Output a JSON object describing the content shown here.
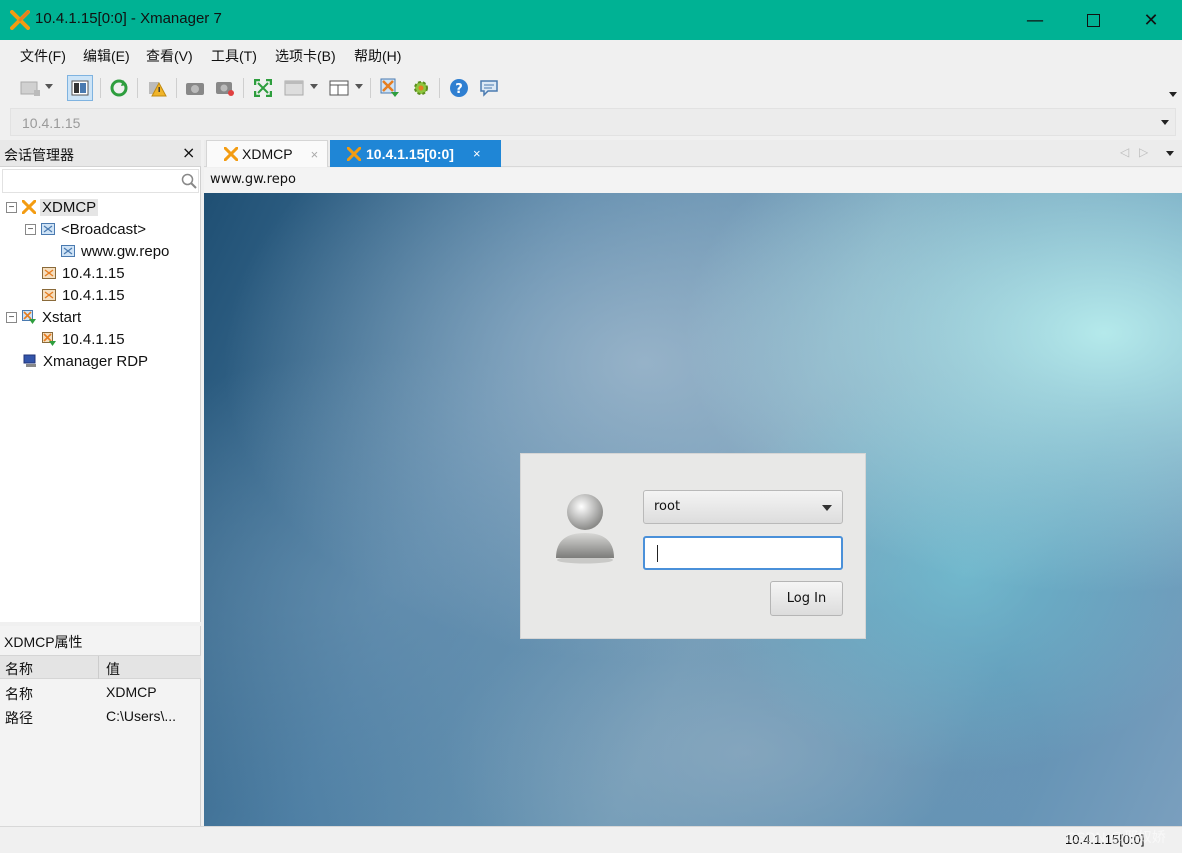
{
  "window": {
    "title": "10.4.1.15[0:0] - Xmanager 7"
  },
  "menu": {
    "items": [
      "文件(F)",
      "编辑(E)",
      "查看(V)",
      "工具(T)",
      "选项卡(B)",
      "帮助(H)"
    ]
  },
  "toolbar": {
    "icons": [
      "new-session-icon",
      "session-panel-icon",
      "refresh-icon",
      "warning-icon",
      "screenshot-icon",
      "record-icon",
      "fullscreen-icon",
      "window-icon",
      "layout-icon",
      "xstart-icon",
      "settings-icon",
      "help-icon",
      "chat-icon"
    ]
  },
  "address": {
    "value": "10.4.1.15"
  },
  "session_manager": {
    "title": "会话管理器",
    "tree": {
      "xdmcp": "XDMCP",
      "broadcast": "<Broadcast>",
      "broadcast_child": "www.gw.repo",
      "xdmcp_host1": "10.4.1.15",
      "xdmcp_host2": "10.4.1.15",
      "xstart": "Xstart",
      "xstart_host": "10.4.1.15",
      "rdp": "Xmanager RDP"
    }
  },
  "properties": {
    "title": "XDMCP属性",
    "col_name": "名称",
    "col_value": "值",
    "rows": [
      {
        "name": "名称",
        "value": "XDMCP"
      },
      {
        "name": "路径",
        "value": "C:\\Users\\..."
      }
    ]
  },
  "tabs": [
    {
      "label": "XDMCP",
      "active": false
    },
    {
      "label": "10.4.1.15[0:0]",
      "active": true
    }
  ],
  "session_url": "www.gw.repo",
  "login": {
    "user": "root",
    "password_value": "",
    "button": "Log In"
  },
  "statusbar": {
    "text": "10.4.1.15[0:0]",
    "watermark": "CSDN @邢奴娇"
  },
  "colors": {
    "titlebar": "#00b294",
    "active_tab": "#1f86d6",
    "logo": "#f39c12"
  }
}
